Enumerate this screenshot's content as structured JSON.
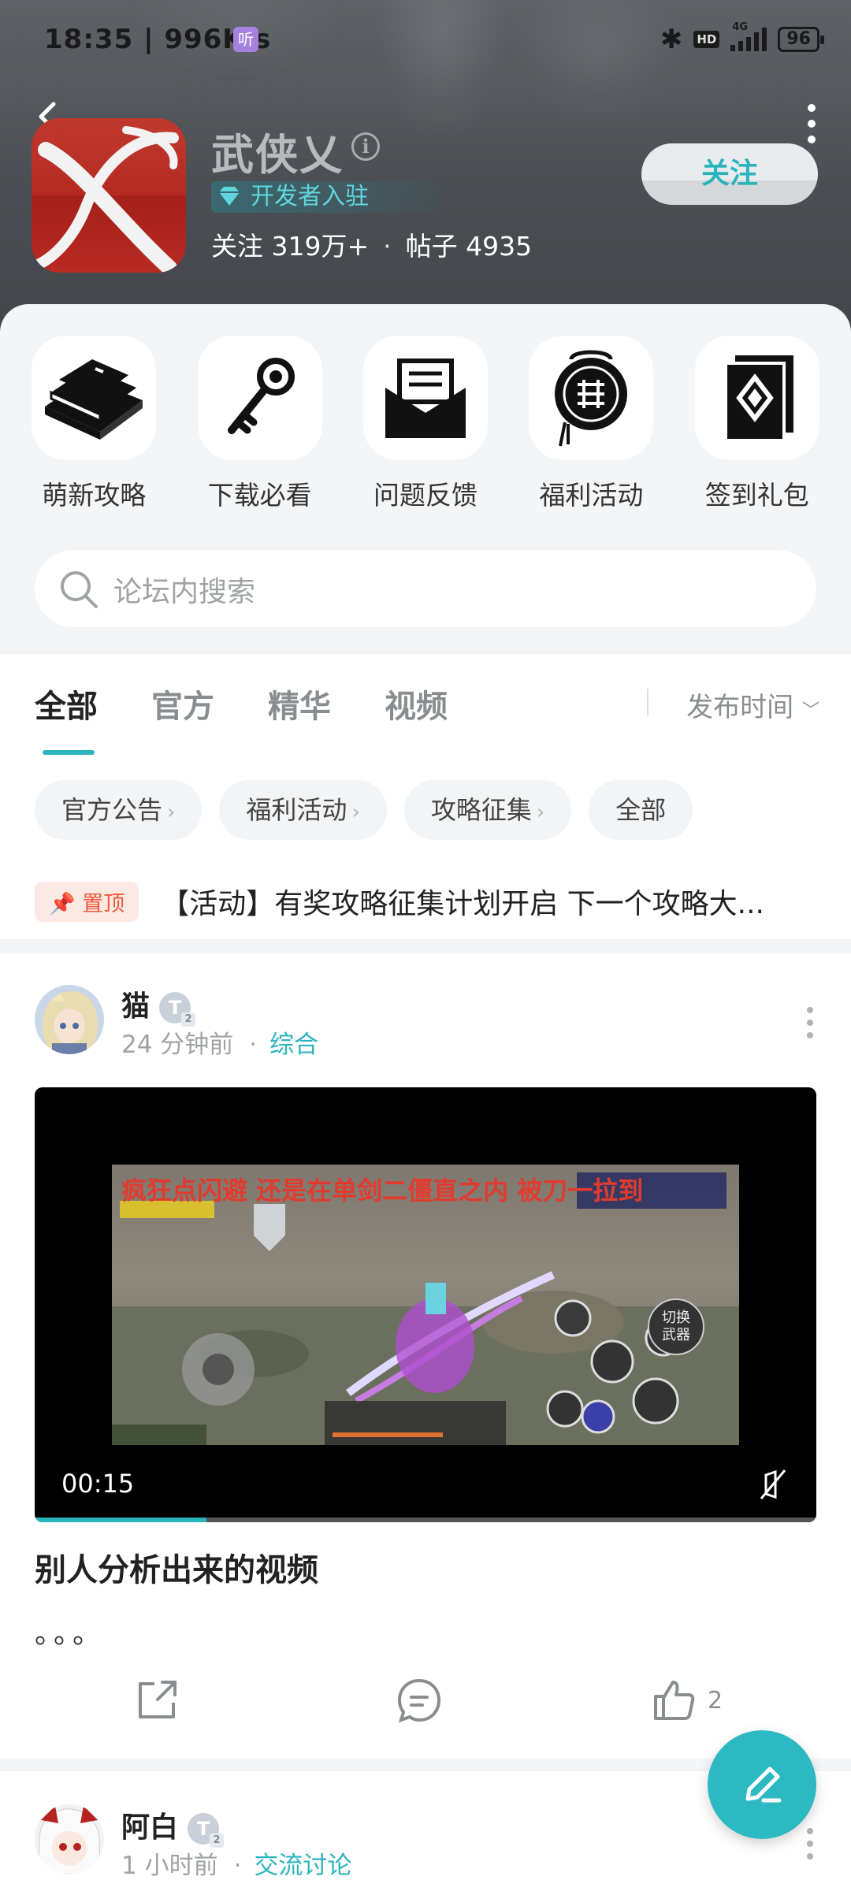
{
  "status_bar": {
    "time": "18:35 | 996K/s",
    "hear_badge": "听",
    "hd": "HD",
    "network": "4G",
    "battery": "96"
  },
  "forum": {
    "title": "武侠乂",
    "developer_badge": "开发者入驻",
    "followers_label": "关注",
    "followers": "319万+",
    "posts_label": "帖子",
    "posts": "4935",
    "follow_button": "关注"
  },
  "quick_links": [
    {
      "label": "萌新攻略",
      "icon": "book-stack-icon"
    },
    {
      "label": "下载必看",
      "icon": "key-icon"
    },
    {
      "label": "问题反馈",
      "icon": "envelope-icon"
    },
    {
      "label": "福利活动",
      "icon": "medallion-icon"
    },
    {
      "label": "签到礼包",
      "icon": "gift-card-icon"
    }
  ],
  "search": {
    "placeholder": "论坛内搜索"
  },
  "tabs": [
    "全部",
    "官方",
    "精华",
    "视频"
  ],
  "active_tab": "全部",
  "sort": {
    "label": "发布时间"
  },
  "chips": [
    "官方公告",
    "福利活动",
    "攻略征集",
    "全部"
  ],
  "pinned": {
    "badge": "置顶",
    "title": "【活动】有奖攻略征集计划开启 下一个攻略大..."
  },
  "post1": {
    "user": "猫",
    "level": "T",
    "time": "24 分钟前",
    "category": "综合",
    "video": {
      "duration": "00:15",
      "caption": "疯狂点闪避 还是在单剑二僵直之内 被刀一拉到",
      "button_1": "切换",
      "button_2": "武器",
      "progress": 0.22
    },
    "title": "别人分析出来的视频",
    "body": "。。。",
    "likes": "2"
  },
  "post2": {
    "user": "阿白",
    "level": "T",
    "time": "1 小时前",
    "category": "交流讨论"
  },
  "colors": {
    "accent": "#2cb4bd",
    "pin": "#f05a3c"
  }
}
